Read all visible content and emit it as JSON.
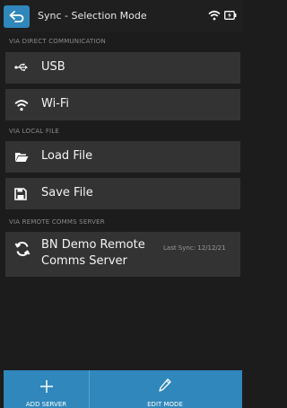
{
  "header": {
    "title": "Sync - Selection Mode",
    "back_icon": "back-arrow-icon",
    "status_icons": [
      "wifi-icon",
      "battery-icon"
    ]
  },
  "sections": {
    "direct": {
      "label": "VIA DIRECT COMMUNICATION",
      "items": [
        {
          "label": "USB",
          "icon": "usb-icon"
        },
        {
          "label": "Wi-Fi",
          "icon": "wifi-icon"
        }
      ]
    },
    "local": {
      "label": "VIA LOCAL FILE",
      "items": [
        {
          "label": "Load File",
          "icon": "folder-icon"
        },
        {
          "label": "Save File",
          "icon": "save-icon"
        }
      ]
    },
    "remote": {
      "label": "VIA REMOTE COMMS SERVER",
      "servers": [
        {
          "name": "BN Demo Remote Comms Server",
          "last_sync": "Last Sync: 12/12/21",
          "icon": "sync-icon"
        }
      ]
    }
  },
  "bottom_bar": {
    "add_label": "ADD SERVER",
    "edit_label": "EDIT MODE"
  },
  "colors": {
    "accent": "#2f87bb",
    "background": "#1c1c1c",
    "row": "#333333"
  }
}
